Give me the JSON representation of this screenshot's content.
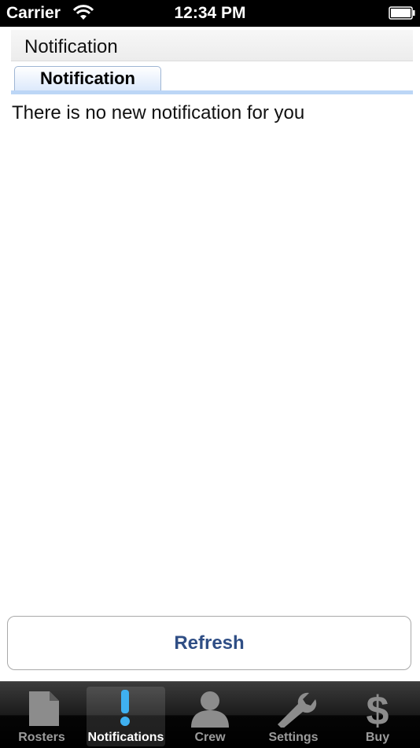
{
  "status_bar": {
    "carrier": "Carrier",
    "time": "12:34 PM",
    "wifi_icon": "wifi-icon",
    "battery_icon": "battery-icon"
  },
  "header": {
    "title": "Notification"
  },
  "tabs": [
    {
      "label": "Notification",
      "active": true
    }
  ],
  "message": "There is no new notification for you",
  "refresh_button": {
    "label": "Refresh"
  },
  "tab_bar": {
    "items": [
      {
        "label": "Rosters",
        "icon": "document-icon",
        "selected": false
      },
      {
        "label": "Notifications",
        "icon": "exclamation-icon",
        "selected": true
      },
      {
        "label": "Crew",
        "icon": "person-icon",
        "selected": false
      },
      {
        "label": "Settings",
        "icon": "wrench-icon",
        "selected": false
      },
      {
        "label": "Buy",
        "icon": "dollar-icon",
        "selected": false
      }
    ]
  },
  "colors": {
    "accent_blue": "#2f4e85",
    "tab_highlight": "#bcd6f6",
    "selected_icon": "#3fb0f0"
  }
}
